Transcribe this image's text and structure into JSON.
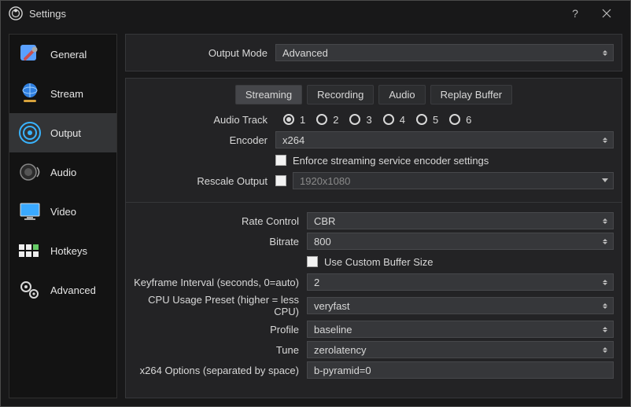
{
  "window": {
    "title": "Settings"
  },
  "sidebar": {
    "items": [
      {
        "label": "General"
      },
      {
        "label": "Stream"
      },
      {
        "label": "Output"
      },
      {
        "label": "Audio"
      },
      {
        "label": "Video"
      },
      {
        "label": "Hotkeys"
      },
      {
        "label": "Advanced"
      }
    ],
    "active_index": 2
  },
  "output_mode": {
    "label": "Output Mode",
    "value": "Advanced"
  },
  "tabs": {
    "items": [
      {
        "label": "Streaming"
      },
      {
        "label": "Recording"
      },
      {
        "label": "Audio"
      },
      {
        "label": "Replay Buffer"
      }
    ],
    "active_index": 0
  },
  "streaming": {
    "audio_track": {
      "label": "Audio Track",
      "options": [
        "1",
        "2",
        "3",
        "4",
        "5",
        "6"
      ],
      "selected": "1"
    },
    "encoder": {
      "label": "Encoder",
      "value": "x264"
    },
    "enforce": {
      "label": "Enforce streaming service encoder settings",
      "checked": false
    },
    "rescale": {
      "label": "Rescale Output",
      "checked": false,
      "value": "1920x1080"
    },
    "rate_control": {
      "label": "Rate Control",
      "value": "CBR"
    },
    "bitrate": {
      "label": "Bitrate",
      "value": "800"
    },
    "custom_buffer": {
      "label": "Use Custom Buffer Size",
      "checked": false
    },
    "keyframe": {
      "label": "Keyframe Interval (seconds, 0=auto)",
      "value": "2"
    },
    "cpu_preset": {
      "label": "CPU Usage Preset (higher = less CPU)",
      "value": "veryfast"
    },
    "profile": {
      "label": "Profile",
      "value": "baseline"
    },
    "tune": {
      "label": "Tune",
      "value": "zerolatency"
    },
    "x264_opts": {
      "label": "x264 Options (separated by space)",
      "value": "b-pyramid=0"
    }
  }
}
